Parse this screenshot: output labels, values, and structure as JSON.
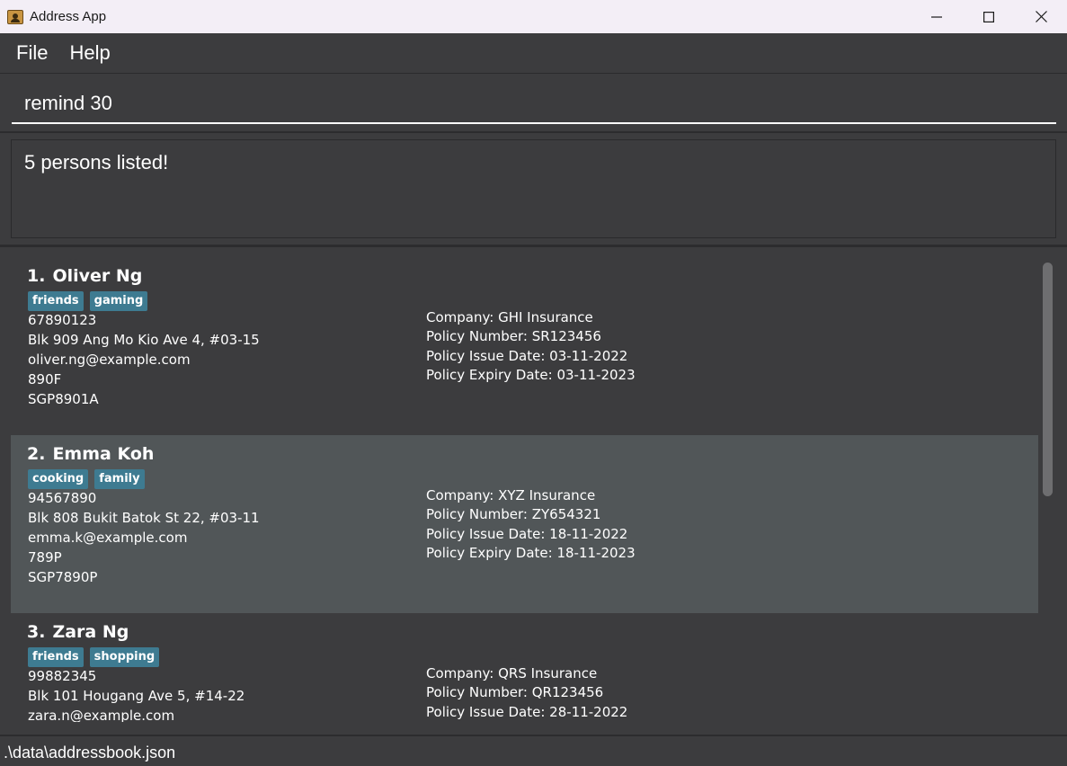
{
  "window": {
    "title": "Address App",
    "icon": "address-book-icon"
  },
  "menu": {
    "items": [
      "File",
      "Help"
    ]
  },
  "command": {
    "value": "remind 30"
  },
  "result": {
    "message": "5 persons listed!"
  },
  "persons": [
    {
      "index": "1.",
      "name": "Oliver Ng",
      "tags": [
        "friends",
        "gaming"
      ],
      "phone": "67890123",
      "address": "Blk 909 Ang Mo Kio Ave 4, #03-15",
      "email": "oliver.ng@example.com",
      "field4": "890F",
      "field5": "SGP8901A",
      "company": "Company: GHI Insurance",
      "policy_number": "Policy Number: SR123456",
      "issue_date": "Policy Issue Date: 03-11-2022",
      "expiry_date": "Policy Expiry Date: 03-11-2023"
    },
    {
      "index": "2.",
      "name": "Emma Koh",
      "tags": [
        "cooking",
        "family"
      ],
      "phone": "94567890",
      "address": "Blk 808 Bukit Batok St 22, #03-11",
      "email": "emma.k@example.com",
      "field4": "789P",
      "field5": "SGP7890P",
      "company": "Company: XYZ Insurance",
      "policy_number": "Policy Number: ZY654321",
      "issue_date": "Policy Issue Date: 18-11-2022",
      "expiry_date": "Policy Expiry Date: 18-11-2023"
    },
    {
      "index": "3.",
      "name": "Zara Ng",
      "tags": [
        "friends",
        "shopping"
      ],
      "phone": "99882345",
      "address": "Blk 101 Hougang Ave 5, #14-22",
      "email": "zara.n@example.com",
      "company": "Company: QRS Insurance",
      "policy_number": "Policy Number: QR123456",
      "issue_date": "Policy Issue Date: 28-11-2022"
    }
  ],
  "status": {
    "file_path": ".\\data\\addressbook.json"
  },
  "colors": {
    "background": "#3c3c3e",
    "selected_card": "#515658",
    "tag": "#3e7b91",
    "title_bar": "#f3eef6"
  }
}
